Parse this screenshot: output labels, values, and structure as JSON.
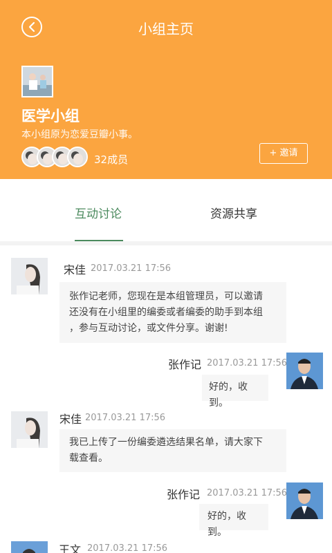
{
  "header": {
    "title": "小组主页",
    "group_name": "医学小组",
    "group_desc": "本小组原为恋爱豆瓣小事。",
    "member_count": "32成员",
    "invite_label": "+ 邀请"
  },
  "tabs": [
    {
      "label": "互动讨论",
      "active": true
    },
    {
      "label": "资源共享",
      "active": false
    }
  ],
  "messages": [
    {
      "name": "宋佳",
      "time": "2017.03.21 17:56",
      "side": "left",
      "text_lines": [
        "张作记老师，您现在是本组管理员，可以邀请",
        "还没有在小组里的编委或者编委的助手到本组",
        "，参与互动讨论，或文件分享。谢谢!"
      ]
    },
    {
      "name": "张作记",
      "time": "2017.03.21 17:56",
      "side": "right",
      "text_lines": [
        "好的，收到。"
      ]
    },
    {
      "name": "宋佳",
      "time": "2017.03.21 17:56",
      "side": "left",
      "text_lines": [
        "我已上传了一份编委遴选结果名单，请大家下",
        "载查看。"
      ]
    },
    {
      "name": "张作记",
      "time": "2017.03.21 17:56",
      "side": "right",
      "text_lines": [
        "好的，收到。"
      ]
    },
    {
      "name": "王文",
      "time": "2017.03.21 17:56",
      "side": "left",
      "text_lines": []
    }
  ],
  "colors": {
    "accent": "#fba540",
    "tab_active": "#4b8a5e"
  }
}
